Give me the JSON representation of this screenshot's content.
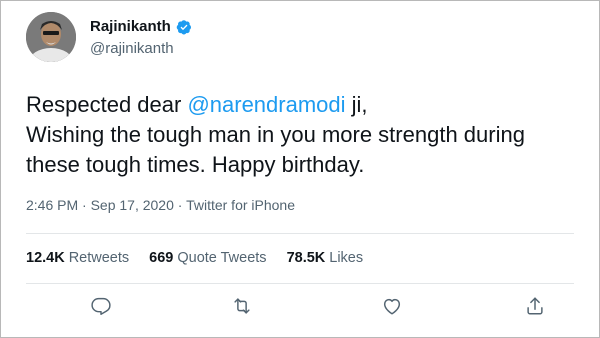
{
  "tweet": {
    "author": {
      "display_name": "Rajinikanth",
      "handle": "@rajinikanth",
      "verified": true
    },
    "text": {
      "line1_prefix": "Respected dear ",
      "mention": "@narendramodi",
      "line1_suffix": " ji,",
      "line2": "Wishing the tough man in you more strength during",
      "line3": "these tough times. Happy birthday."
    },
    "meta": "2:46 PM · Sep 17, 2020 · Twitter for iPhone",
    "stats": [
      {
        "count": "12.4K",
        "label": "Retweets"
      },
      {
        "count": "669",
        "label": "Quote Tweets"
      },
      {
        "count": "78.5K",
        "label": "Likes"
      }
    ],
    "actions": [
      "reply-icon",
      "retweet-icon",
      "like-icon",
      "share-icon"
    ]
  },
  "colors": {
    "accent": "#1d9bf0",
    "text": "#0f1419",
    "secondary": "#536471"
  }
}
